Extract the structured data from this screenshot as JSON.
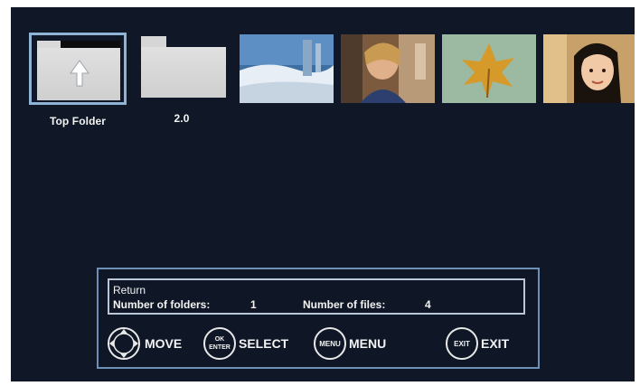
{
  "thumbnails": [
    {
      "type": "folder",
      "label": "Top Folder",
      "selected": true,
      "icon": "up-arrow-icon"
    },
    {
      "type": "folder",
      "label": "2.0",
      "selected": false,
      "icon": "folder-icon"
    },
    {
      "type": "photo",
      "subject": "snow-scene"
    },
    {
      "type": "photo",
      "subject": "woman-portrait"
    },
    {
      "type": "photo",
      "subject": "autumn-leaf"
    },
    {
      "type": "photo",
      "subject": "child-portrait"
    }
  ],
  "info": {
    "title": "Return",
    "folders_label": "Number of folders:",
    "folders_value": "1",
    "files_label": "Number of files:",
    "files_value": "4"
  },
  "controls": {
    "move": {
      "label": "MOVE",
      "icon": "dpad-icon"
    },
    "select": {
      "label": "SELECT",
      "icon_top": "OK",
      "icon_bottom": "ENTER"
    },
    "menu": {
      "label": "MENU",
      "icon_text": "MENU"
    },
    "exit": {
      "label": "EXIT",
      "icon_text": "EXIT"
    }
  },
  "colors": {
    "screen_bg": "#101827",
    "panel_border": "#6e90b8",
    "selection_border": "#8fb3d4",
    "text": "#f3f3f3"
  }
}
